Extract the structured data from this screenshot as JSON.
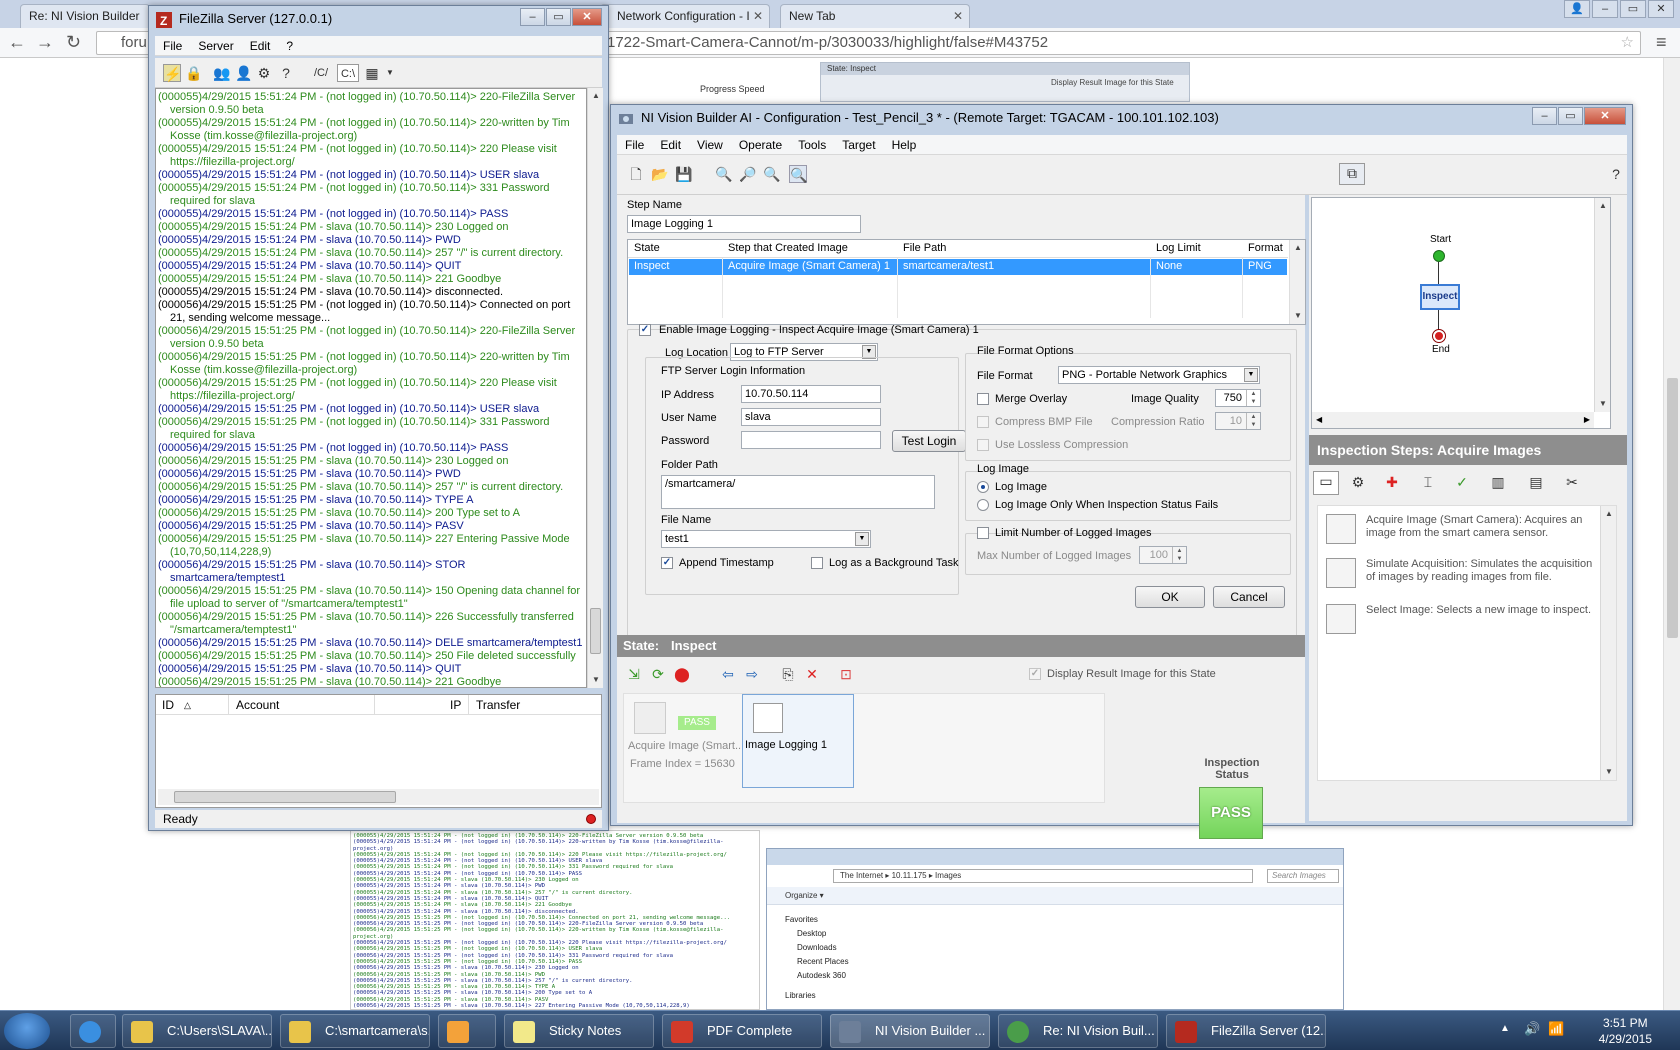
{
  "browser": {
    "tabs": [
      {
        "title": "Re: NI Vision Builder"
      },
      {
        "title": "Network Configuration - I"
      },
      {
        "title": "New Tab"
      }
    ],
    "address": "forum...1722-Smart-Camera-Cannot/m-p/3030033/highlight/false#M43752",
    "address_left": "foru",
    "address_right": "1722-Smart-Camera-Cannot/m-p/3030033/highlight/false#M43752",
    "bg_progress_label": "Progress   Speed",
    "bg_state_label": "State:   Inspect",
    "bg_display_label": "Display Result Image for this State"
  },
  "filezilla": {
    "title": "FileZilla Server (127.0.0.1)",
    "menu": [
      "File",
      "Server",
      "Edit",
      "?"
    ],
    "toolbar_paths": [
      "/C/",
      "C:\\"
    ],
    "log": [
      {
        "c": "g",
        "t": "(000055)4/29/2015 15:51:24 PM - (not logged in) (10.70.50.114)> 220-FileZilla Server version 0.9.50 beta"
      },
      {
        "c": "g",
        "t": "(000055)4/29/2015 15:51:24 PM - (not logged in) (10.70.50.114)> 220-written by Tim Kosse (tim.kosse@filezilla-project.org)"
      },
      {
        "c": "g",
        "t": "(000055)4/29/2015 15:51:24 PM - (not logged in) (10.70.50.114)> 220 Please visit https://filezilla-project.org/"
      },
      {
        "c": "b",
        "t": "(000055)4/29/2015 15:51:24 PM - (not logged in) (10.70.50.114)> USER slava"
      },
      {
        "c": "g",
        "t": "(000055)4/29/2015 15:51:24 PM - (not logged in) (10.70.50.114)> 331 Password required for slava"
      },
      {
        "c": "b",
        "t": "(000055)4/29/2015 15:51:24 PM - (not logged in) (10.70.50.114)> PASS"
      },
      {
        "c": "g",
        "t": "(000055)4/29/2015 15:51:24 PM - slava (10.70.50.114)> 230 Logged on"
      },
      {
        "c": "b",
        "t": "(000055)4/29/2015 15:51:24 PM - slava (10.70.50.114)> PWD"
      },
      {
        "c": "g",
        "t": "(000055)4/29/2015 15:51:24 PM - slava (10.70.50.114)> 257 \"/\" is current directory."
      },
      {
        "c": "b",
        "t": "(000055)4/29/2015 15:51:24 PM - slava (10.70.50.114)> QUIT"
      },
      {
        "c": "g",
        "t": "(000055)4/29/2015 15:51:24 PM - slava (10.70.50.114)> 221 Goodbye"
      },
      {
        "c": "k",
        "t": "(000055)4/29/2015 15:51:24 PM - slava (10.70.50.114)> disconnected."
      },
      {
        "c": "k",
        "t": "(000056)4/29/2015 15:51:25 PM - (not logged in) (10.70.50.114)> Connected on port 21, sending welcome message..."
      },
      {
        "c": "g",
        "t": "(000056)4/29/2015 15:51:25 PM - (not logged in) (10.70.50.114)> 220-FileZilla Server version 0.9.50 beta"
      },
      {
        "c": "g",
        "t": "(000056)4/29/2015 15:51:25 PM - (not logged in) (10.70.50.114)> 220-written by Tim Kosse (tim.kosse@filezilla-project.org)"
      },
      {
        "c": "g",
        "t": "(000056)4/29/2015 15:51:25 PM - (not logged in) (10.70.50.114)> 220 Please visit https://filezilla-project.org/"
      },
      {
        "c": "b",
        "t": "(000056)4/29/2015 15:51:25 PM - (not logged in) (10.70.50.114)> USER slava"
      },
      {
        "c": "g",
        "t": "(000056)4/29/2015 15:51:25 PM - (not logged in) (10.70.50.114)> 331 Password required for slava"
      },
      {
        "c": "b",
        "t": "(000056)4/29/2015 15:51:25 PM - (not logged in) (10.70.50.114)> PASS"
      },
      {
        "c": "g",
        "t": "(000056)4/29/2015 15:51:25 PM - slava (10.70.50.114)> 230 Logged on"
      },
      {
        "c": "b",
        "t": "(000056)4/29/2015 15:51:25 PM - slava (10.70.50.114)> PWD"
      },
      {
        "c": "g",
        "t": "(000056)4/29/2015 15:51:25 PM - slava (10.70.50.114)> 257 \"/\" is current directory."
      },
      {
        "c": "b",
        "t": "(000056)4/29/2015 15:51:25 PM - slava (10.70.50.114)> TYPE A"
      },
      {
        "c": "g",
        "t": "(000056)4/29/2015 15:51:25 PM - slava (10.70.50.114)> 200 Type set to A"
      },
      {
        "c": "b",
        "t": "(000056)4/29/2015 15:51:25 PM - slava (10.70.50.114)> PASV"
      },
      {
        "c": "g",
        "t": "(000056)4/29/2015 15:51:25 PM - slava (10.70.50.114)> 227 Entering Passive Mode (10,70,50,114,228,9)"
      },
      {
        "c": "b",
        "t": "(000056)4/29/2015 15:51:25 PM - slava (10.70.50.114)> STOR smartcamera/temptest1"
      },
      {
        "c": "g",
        "t": "(000056)4/29/2015 15:51:25 PM - slava (10.70.50.114)> 150 Opening data channel for file upload to server of \"/smartcamera/temptest1\""
      },
      {
        "c": "g",
        "t": "(000056)4/29/2015 15:51:25 PM - slava (10.70.50.114)> 226 Successfully transferred \"/smartcamera/temptest1\""
      },
      {
        "c": "b",
        "t": "(000056)4/29/2015 15:51:25 PM - slava (10.70.50.114)> DELE smartcamera/temptest1"
      },
      {
        "c": "g",
        "t": "(000056)4/29/2015 15:51:25 PM - slava (10.70.50.114)> 250 File deleted successfully"
      },
      {
        "c": "b",
        "t": "(000056)4/29/2015 15:51:25 PM - slava (10.70.50.114)> QUIT"
      },
      {
        "c": "g",
        "t": "(000056)4/29/2015 15:51:25 PM - slava (10.70.50.114)> 221 Goodbye"
      },
      {
        "c": "k",
        "t": "(000056)4/29/2015 15:51:25 PM - slava (10.70.50.114)> disconnected."
      }
    ],
    "queue_columns": {
      "id": "ID",
      "account": "Account",
      "ip": "IP",
      "transfer": "Transfer"
    },
    "status": "Ready"
  },
  "ni": {
    "title": "NI Vision Builder AI - Configuration - Test_Pencil_3 * - (Remote Target: TGACAM - 100.101.102.103)",
    "menu": [
      "File",
      "Edit",
      "View",
      "Operate",
      "Tools",
      "Target",
      "Help"
    ],
    "step_name_label": "Step Name",
    "step_name_value": "Image Logging 1",
    "grid": {
      "columns": [
        "State",
        "Step that Created Image",
        "File Path",
        "Log Limit",
        "Format"
      ],
      "row": [
        "Inspect",
        "Acquire Image (Smart Camera) 1",
        "smartcamera/test1",
        "None",
        "PNG"
      ]
    },
    "enable_logging_label": "Enable Image Logging - Inspect Acquire Image (Smart Camera) 1",
    "log_location_label": "Log Location",
    "log_location_value": "Log to FTP Server",
    "ftp_section_label": "FTP Server Login Information",
    "ip_label": "IP Address",
    "ip_value": "10.70.50.114",
    "user_label": "User Name",
    "user_value": "slava",
    "password_label": "Password",
    "password_value": "",
    "test_login_label": "Test Login",
    "folder_label": "Folder Path",
    "folder_value": "/smartcamera/",
    "file_name_label": "File Name",
    "file_name_value": "test1",
    "append_timestamp_label": "Append Timestamp",
    "background_task_label": "Log as a Background Task",
    "format_section_label": "File Format Options",
    "file_format_label": "File Format",
    "file_format_value": "PNG - Portable Network Graphics",
    "merge_overlay_label": "Merge Overlay",
    "image_quality_label": "Image Quality",
    "image_quality_value": "750",
    "compress_bmp_label": "Compress BMP File",
    "compression_ratio_label": "Compression Ratio",
    "compression_ratio_value": "10",
    "lossless_label": "Use Lossless Compression",
    "log_image_section_label": "Log Image",
    "log_image_radio_label": "Log Image",
    "log_fail_radio_label": "Log Image Only When Inspection Status Fails",
    "limit_label": "Limit Number of Logged Images",
    "max_logged_label": "Max Number of Logged Images",
    "max_logged_value": "100",
    "ok_label": "OK",
    "cancel_label": "Cancel",
    "state_label": "State:",
    "state_value": "Inspect",
    "display_result_label": "Display Result Image for this State",
    "step1_label": "Acquire Image (Smart...",
    "step1_sub": "Frame Index = 15630",
    "step1_pass": "PASS",
    "step2_label": "Image Logging 1",
    "inspection_status_label": "Inspection Status",
    "inspection_status_value": "PASS",
    "flow": {
      "start": "Start",
      "inspect": "Inspect",
      "end": "End"
    },
    "insp_steps_title": "Inspection Steps: Acquire Images",
    "insp_items": [
      {
        "name": "Acquire Image (Smart Camera):",
        "desc": " Acquires an image from the smart camera sensor."
      },
      {
        "name": "Simulate Acquisition:",
        "desc": " Simulates the acquisition of images by reading images from file."
      },
      {
        "name": "Select Image:",
        "desc": " Selects a new image to inspect."
      }
    ]
  },
  "explorer": {
    "address": "The Internet  ▸  10.11.175  ▸  Images",
    "search_placeholder": "Search Images",
    "organize": "Organize ▾",
    "nav": [
      "Favorites",
      "Desktop",
      "Downloads",
      "Recent Places",
      "Autodesk 360",
      "Libraries"
    ]
  },
  "taskbar": {
    "items": [
      {
        "label": "C:\\Users\\SLAVA\\...",
        "color": "#e8c44a"
      },
      {
        "label": "C:\\smartcamera\\s...",
        "color": "#e8c44a"
      },
      {
        "label": "",
        "color": "#f3a23a"
      },
      {
        "label": "Sticky Notes",
        "color": "#f2e98a"
      },
      {
        "label": "PDF Complete",
        "color": "#d23a2a"
      },
      {
        "label": "NI Vision Builder ...",
        "color": "#6d7f99"
      },
      {
        "label": "Re: NI Vision Buil...",
        "color": "#4a9d4a"
      },
      {
        "label": "FileZilla Server (12...",
        "color": "#b52a1f"
      }
    ],
    "time": "3:51 PM",
    "date": "4/29/2015"
  }
}
